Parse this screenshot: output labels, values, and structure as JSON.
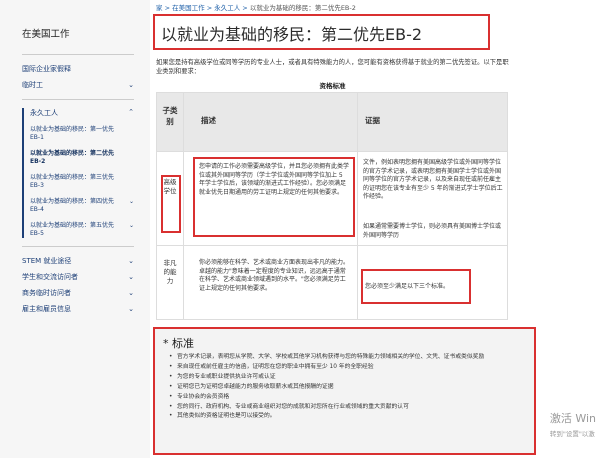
{
  "sidebar": {
    "title": "在美国工作",
    "items_top": [
      {
        "label": "国际企业家假释",
        "chevron": ""
      },
      {
        "label": "临时工",
        "chevron": "⌄"
      }
    ],
    "group": {
      "label": "永久工人",
      "chevron": "⌃",
      "subs": [
        {
          "label": "以就业为基础的移民：第一优先EB-1",
          "active": false
        },
        {
          "label": "以就业为基础的移民：第二优先EB-2",
          "active": true
        },
        {
          "label": "以就业为基础的移民：第三优先EB-3",
          "active": false
        },
        {
          "label": "以就业为基础的移民：第四优先EB-4",
          "active": false
        },
        {
          "label": "以就业为基础的移民：第五优先EB-5",
          "active": false
        }
      ]
    },
    "items_bottom": [
      {
        "label": "STEM 就业途径",
        "chevron": "⌄"
      },
      {
        "label": "学生和交流访问者",
        "chevron": "⌄"
      },
      {
        "label": "商务临时访问者",
        "chevron": "⌄"
      },
      {
        "label": "雇主和雇员信息",
        "chevron": "⌄"
      }
    ]
  },
  "breadcrumb": {
    "home": "家",
    "sep": ">",
    "l1": "在美国工作",
    "l2": "永久工人",
    "current": "以就业为基础的移民：第二优先EB-2"
  },
  "page": {
    "title": "以就业为基础的移民：第二优先EB-2",
    "intro": "如果您是持有高级学位或同等学历的专业人士，或者具有特殊能力的人，您可能有资格获得基于就业的第二优先签证。以下是职业类别和要求：",
    "table_caption": "资格标准"
  },
  "table": {
    "headers": {
      "category": "子类别",
      "description": "描述",
      "evidence": "证据"
    },
    "rows": [
      {
        "category": "高级学位",
        "description": "您申请的工作必须需要高级学位，并且您必须拥有此类学位或其外国同等学历（学士学位或外国同等学位加上 5 年学士学位后，该领域的渐进式工作经验）。您必须满足就业优先日期通用的劳工证明上规定的任何其他要求。",
        "evidence": "文件，例如表明您拥有美国高级学位或外国同等学位的官方学术记录，或表明您拥有美国学士学位或外国同等学位的官方学术记录，以及来自现任或前任雇主的证明您在该专业有至少 5 年的渐进式学士学位后工作经验。",
        "evidence2": "如果通常需要博士学位，则必须具有美国博士学位或外国同等学历"
      },
      {
        "category": "非凡的能力",
        "description": "你必须能够在科学、艺术或商业方面表现出非凡的能力。卓越的能力\"意味着一定程度的专业知识，远远高于通常在科学、艺术或商业领域遇到的水平。\"您必须满足劳工证上规定的任何其他要求。",
        "evidence": "您必须至少满足以下三个标准。"
      }
    ]
  },
  "criteria": {
    "title": "* 标准",
    "items": [
      "官方学术记录，表明您从学院、大学、学校或其他学习机构获得与您的特殊能力领域相关的学位、文凭、证书或类似奖励",
      "来自现任或前任雇主的信函，证明您在您的职业中拥有至少 10 年的全职经验",
      "为您的专业或职业提供执业许可或认证",
      "证明您已为证明您卓越能力的服务收取薪水或其他报酬的证据",
      "专业协会的会员资格",
      "您的同行、政府机构、专业或商业组织对您的成就和对您所在行业或领域的重大贡献的认可",
      "其他类似的资格证明也是可以接受的。"
    ]
  },
  "watermark": {
    "line1": "激活 Win",
    "line2": "转到\"设置\"以激"
  },
  "colors": {
    "highlight": "#d93030",
    "link": "#1d3f77"
  }
}
